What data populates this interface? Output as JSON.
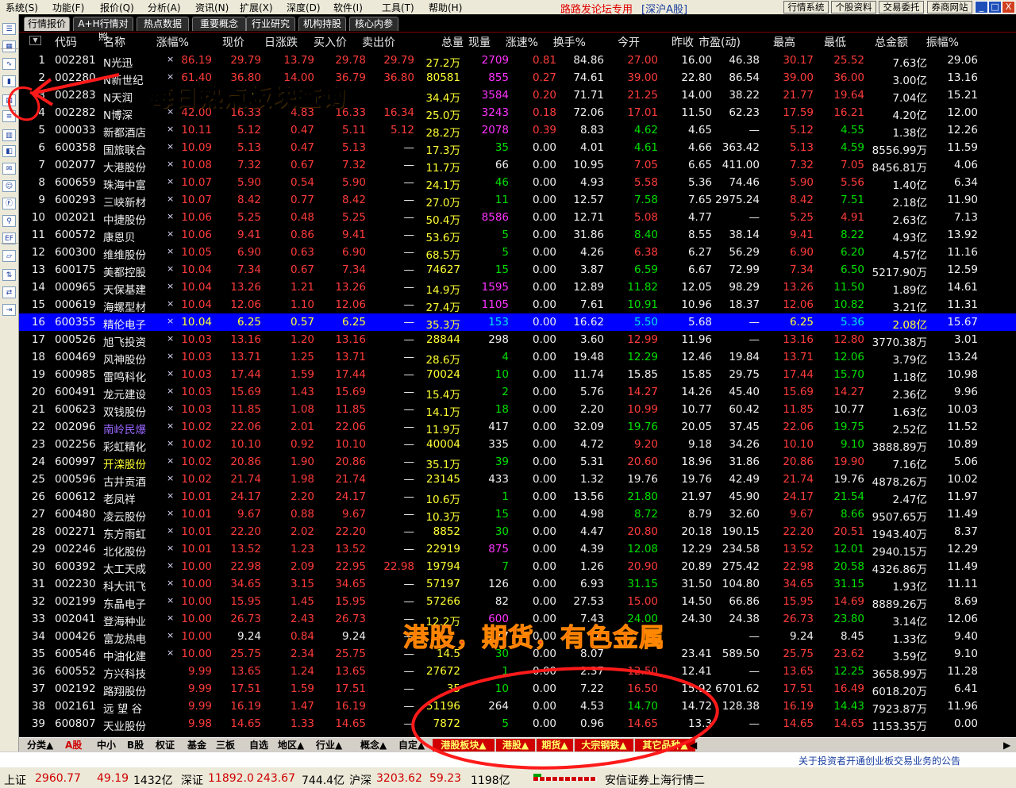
{
  "menu": {
    "items": [
      "系统(S)",
      "功能(F)",
      "报价(Q)",
      "分析(A)",
      "资讯(N)",
      "扩展(X)",
      "深度(D)",
      "软件(I)",
      "工具(T)",
      "帮助(H)"
    ],
    "center": "路路发论坛专用",
    "market": "[深沪A股]",
    "right_buttons": [
      "行情系统",
      "个股资料",
      "交易委托",
      "券商网站"
    ],
    "window_buttons": [
      "_",
      "□",
      "X"
    ]
  },
  "tabs": [
    "行情报价",
    "A+H行情对照",
    "热点数据",
    "重要概念",
    "行业研究",
    "机构持股",
    "核心内参"
  ],
  "header": {
    "columns": [
      "代码",
      "名称",
      "涨幅%",
      "现价",
      "日涨跌",
      "买入价",
      "卖出价",
      "总量",
      "现量",
      "涨速%",
      "换手%",
      "今开",
      "昨收",
      "市盈(动)",
      "最高",
      "最低",
      "总金额",
      "振幅%"
    ]
  },
  "rows": [
    [
      "1",
      "002281",
      "N光迅",
      "86.19",
      "29.79",
      "13.79",
      "29.78",
      "29.79",
      "27.2万",
      "2709",
      "0.81",
      "84.86",
      "27.00",
      "16.00",
      "46.38",
      "30.17",
      "25.52",
      "7.63亿",
      "29.06"
    ],
    [
      "2",
      "002280",
      "N新世纪",
      "61.40",
      "36.80",
      "14.00",
      "36.79",
      "36.80",
      "80581",
      "855",
      "0.27",
      "74.61",
      "39.00",
      "22.80",
      "86.54",
      "39.00",
      "36.00",
      "3.00亿",
      "13.16"
    ],
    [
      "3",
      "002283",
      "N天润",
      "",
      "",
      "",
      "",
      "",
      "34.4万",
      "3584",
      "0.20",
      "71.71",
      "21.25",
      "14.00",
      "38.22",
      "21.77",
      "19.64",
      "7.04亿",
      "15.21"
    ],
    [
      "4",
      "002282",
      "N博深",
      "42.00",
      "16.33",
      "4.83",
      "16.33",
      "16.34",
      "25.0万",
      "3243",
      "0.18",
      "72.06",
      "17.01",
      "11.50",
      "62.23",
      "17.59",
      "16.21",
      "4.20亿",
      "12.00"
    ],
    [
      "5",
      "000033",
      "新都酒店",
      "10.11",
      "5.12",
      "0.47",
      "5.11",
      "5.12",
      "28.2万",
      "2078",
      "0.39",
      "8.83",
      "4.62",
      "4.65",
      "—",
      "5.12",
      "4.55",
      "1.38亿",
      "12.26"
    ],
    [
      "6",
      "600358",
      "国旅联合",
      "10.09",
      "5.13",
      "0.47",
      "5.13",
      "—",
      "17.3万",
      "35",
      "0.00",
      "4.01",
      "4.61",
      "4.66",
      "363.42",
      "5.13",
      "4.59",
      "8556.99万",
      "11.59"
    ],
    [
      "7",
      "002077",
      "大港股份",
      "10.08",
      "7.32",
      "0.67",
      "7.32",
      "—",
      "11.7万",
      "66",
      "0.00",
      "10.95",
      "7.05",
      "6.65",
      "411.00",
      "7.32",
      "7.05",
      "8456.81万",
      "4.06"
    ],
    [
      "8",
      "600659",
      "珠海中富",
      "10.07",
      "5.90",
      "0.54",
      "5.90",
      "—",
      "24.1万",
      "46",
      "0.00",
      "4.93",
      "5.58",
      "5.36",
      "74.46",
      "5.90",
      "5.56",
      "1.40亿",
      "6.34"
    ],
    [
      "9",
      "600293",
      "三峡新材",
      "10.07",
      "8.42",
      "0.77",
      "8.42",
      "—",
      "27.0万",
      "11",
      "0.00",
      "12.57",
      "7.58",
      "7.65",
      "2975.24",
      "8.42",
      "7.51",
      "2.18亿",
      "11.90"
    ],
    [
      "10",
      "002021",
      "中捷股份",
      "10.06",
      "5.25",
      "0.48",
      "5.25",
      "—",
      "50.4万",
      "8586",
      "0.00",
      "12.71",
      "5.08",
      "4.77",
      "—",
      "5.25",
      "4.91",
      "2.63亿",
      "7.13"
    ],
    [
      "11",
      "600572",
      "康恩贝",
      "10.06",
      "9.41",
      "0.86",
      "9.41",
      "—",
      "53.6万",
      "5",
      "0.00",
      "31.86",
      "8.40",
      "8.55",
      "38.14",
      "9.41",
      "8.22",
      "4.93亿",
      "13.92"
    ],
    [
      "12",
      "600300",
      "维维股份",
      "10.05",
      "6.90",
      "0.63",
      "6.90",
      "—",
      "68.5万",
      "5",
      "0.00",
      "4.26",
      "6.38",
      "6.27",
      "56.29",
      "6.90",
      "6.20",
      "4.57亿",
      "11.16"
    ],
    [
      "13",
      "600175",
      "美都控股",
      "10.04",
      "7.34",
      "0.67",
      "7.34",
      "—",
      "74627",
      "15",
      "0.00",
      "3.87",
      "6.59",
      "6.67",
      "72.99",
      "7.34",
      "6.50",
      "5217.90万",
      "12.59"
    ],
    [
      "14",
      "000965",
      "天保基建",
      "10.04",
      "13.26",
      "1.21",
      "13.26",
      "—",
      "14.9万",
      "1595",
      "0.00",
      "12.89",
      "11.82",
      "12.05",
      "98.29",
      "13.26",
      "11.50",
      "1.89亿",
      "14.61"
    ],
    [
      "15",
      "000619",
      "海螺型材",
      "10.04",
      "12.06",
      "1.10",
      "12.06",
      "—",
      "27.4万",
      "1105",
      "0.00",
      "7.61",
      "10.91",
      "10.96",
      "18.37",
      "12.06",
      "10.82",
      "3.21亿",
      "11.31"
    ],
    [
      "16",
      "600355",
      "精伦电子",
      "10.04",
      "6.25",
      "0.57",
      "6.25",
      "—",
      "35.3万",
      "153",
      "0.00",
      "16.62",
      "5.50",
      "5.68",
      "—",
      "6.25",
      "5.36",
      "2.08亿",
      "15.67"
    ],
    [
      "17",
      "000526",
      "旭飞投资",
      "10.03",
      "13.16",
      "1.20",
      "13.16",
      "—",
      "28844",
      "298",
      "0.00",
      "3.60",
      "12.99",
      "11.96",
      "—",
      "13.16",
      "12.80",
      "3770.38万",
      "3.01"
    ],
    [
      "18",
      "600469",
      "风神股份",
      "10.03",
      "13.71",
      "1.25",
      "13.71",
      "—",
      "28.6万",
      "4",
      "0.00",
      "19.48",
      "12.29",
      "12.46",
      "19.84",
      "13.71",
      "12.06",
      "3.79亿",
      "13.24"
    ],
    [
      "19",
      "600985",
      "雷鸣科化",
      "10.03",
      "17.44",
      "1.59",
      "17.44",
      "—",
      "70024",
      "10",
      "0.00",
      "11.74",
      "15.85",
      "15.85",
      "29.75",
      "17.44",
      "15.70",
      "1.18亿",
      "10.98"
    ],
    [
      "20",
      "600491",
      "龙元建设",
      "10.03",
      "15.69",
      "1.43",
      "15.69",
      "—",
      "15.4万",
      "2",
      "0.00",
      "5.76",
      "14.27",
      "14.26",
      "45.40",
      "15.69",
      "14.27",
      "2.36亿",
      "9.96"
    ],
    [
      "21",
      "600623",
      "双钱股份",
      "10.03",
      "11.85",
      "1.08",
      "11.85",
      "—",
      "14.1万",
      "18",
      "0.00",
      "2.20",
      "10.99",
      "10.77",
      "60.42",
      "11.85",
      "10.77",
      "1.63亿",
      "10.03"
    ],
    [
      "22",
      "002096",
      "南岭民爆",
      "10.02",
      "22.06",
      "2.01",
      "22.06",
      "—",
      "11.9万",
      "417",
      "0.00",
      "32.09",
      "19.76",
      "20.05",
      "37.45",
      "22.06",
      "19.75",
      "2.52亿",
      "11.52"
    ],
    [
      "23",
      "002256",
      "彩虹精化",
      "10.02",
      "10.10",
      "0.92",
      "10.10",
      "—",
      "40004",
      "335",
      "0.00",
      "4.72",
      "9.20",
      "9.18",
      "34.26",
      "10.10",
      "9.10",
      "3888.89万",
      "10.89"
    ],
    [
      "24",
      "600997",
      "开滦股份",
      "10.02",
      "20.86",
      "1.90",
      "20.86",
      "—",
      "35.1万",
      "39",
      "0.00",
      "5.31",
      "20.60",
      "18.96",
      "31.86",
      "20.86",
      "19.90",
      "7.16亿",
      "5.06"
    ],
    [
      "25",
      "000596",
      "古井贡酒",
      "10.02",
      "21.74",
      "1.98",
      "21.74",
      "—",
      "23145",
      "433",
      "0.00",
      "1.32",
      "19.76",
      "19.76",
      "42.49",
      "21.74",
      "19.76",
      "4878.26万",
      "10.02"
    ],
    [
      "26",
      "600612",
      "老凤祥",
      "10.01",
      "24.17",
      "2.20",
      "24.17",
      "—",
      "10.6万",
      "1",
      "0.00",
      "13.56",
      "21.80",
      "21.97",
      "45.90",
      "24.17",
      "21.54",
      "2.47亿",
      "11.97"
    ],
    [
      "27",
      "600480",
      "凌云股份",
      "10.01",
      "9.67",
      "0.88",
      "9.67",
      "—",
      "10.3万",
      "15",
      "0.00",
      "4.98",
      "8.72",
      "8.79",
      "32.60",
      "9.67",
      "8.66",
      "9507.65万",
      "11.49"
    ],
    [
      "28",
      "002271",
      "东方雨虹",
      "10.01",
      "22.20",
      "2.02",
      "22.20",
      "—",
      "8852",
      "30",
      "0.00",
      "4.47",
      "20.80",
      "20.18",
      "190.15",
      "22.20",
      "20.51",
      "1943.40万",
      "8.37"
    ],
    [
      "29",
      "002246",
      "北化股份",
      "10.01",
      "13.52",
      "1.23",
      "13.52",
      "—",
      "22919",
      "875",
      "0.00",
      "4.39",
      "12.08",
      "12.29",
      "234.58",
      "13.52",
      "12.01",
      "2940.15万",
      "12.29"
    ],
    [
      "30",
      "600392",
      "太工天成",
      "10.00",
      "22.98",
      "2.09",
      "22.95",
      "22.98",
      "19794",
      "7",
      "0.00",
      "1.26",
      "20.90",
      "20.89",
      "275.42",
      "22.98",
      "20.58",
      "4326.86万",
      "11.49"
    ],
    [
      "31",
      "002230",
      "科大讯飞",
      "10.00",
      "34.65",
      "3.15",
      "34.65",
      "—",
      "57197",
      "126",
      "0.00",
      "6.93",
      "31.15",
      "31.50",
      "104.80",
      "34.65",
      "31.15",
      "1.93亿",
      "11.11"
    ],
    [
      "32",
      "002199",
      "东晶电子",
      "10.00",
      "15.95",
      "1.45",
      "15.95",
      "—",
      "57266",
      "82",
      "0.00",
      "27.53",
      "15.00",
      "14.50",
      "66.86",
      "15.95",
      "14.69",
      "8889.26万",
      "8.69"
    ],
    [
      "33",
      "002041",
      "登海种业",
      "10.00",
      "26.73",
      "2.43",
      "26.73",
      "—",
      "12.2万",
      "600",
      "0.00",
      "7.43",
      "24.00",
      "24.30",
      "24.38",
      "26.73",
      "23.80",
      "3.14亿",
      "12.06"
    ],
    [
      "34",
      "000426",
      "富龙热电",
      "10.00",
      "9.24",
      "0.84",
      "9.24",
      "—",
      "",
      "177",
      "0.00",
      "7.",
      "",
      "",
      "—",
      "9.24",
      "8.45",
      "1.33亿",
      "9.40"
    ],
    [
      "35",
      "600546",
      "中油化建",
      "10.00",
      "25.75",
      "2.34",
      "25.75",
      "—",
      "14.5",
      "30",
      "0.00",
      "8.07",
      "",
      "23.41",
      "589.50",
      "25.75",
      "23.62",
      "3.59亿",
      "9.10"
    ],
    [
      "36",
      "600552",
      "方兴科技",
      "9.99",
      "13.65",
      "1.24",
      "13.65",
      "—",
      "27672",
      "1",
      "0.00",
      "2.37",
      "12.50",
      "12.41",
      "—",
      "13.65",
      "12.25",
      "3658.99万",
      "11.28"
    ],
    [
      "37",
      "002192",
      "路翔股份",
      "9.99",
      "17.51",
      "1.59",
      "17.51",
      "—",
      "35",
      "10",
      "0.00",
      "7.22",
      "16.50",
      "15.92",
      "6701.62",
      "17.51",
      "16.49",
      "6018.20万",
      "6.41"
    ],
    [
      "38",
      "002161",
      "远 望 谷",
      "9.99",
      "16.19",
      "1.47",
      "16.19",
      "—",
      "51196",
      "264",
      "0.00",
      "4.53",
      "14.70",
      "14.72",
      "128.38",
      "16.19",
      "14.43",
      "7923.87万",
      "11.96"
    ],
    [
      "39",
      "600807",
      "天业股份",
      "9.98",
      "14.65",
      "1.33",
      "14.65",
      "—",
      "7872",
      "5",
      "0.00",
      "0.96",
      "14.65",
      "13.3",
      "—",
      "14.65",
      "14.65",
      "1153.35万",
      "0.00"
    ]
  ],
  "bottom_tabs": [
    "分类▲",
    "A股",
    "中小",
    "B股",
    "权证",
    "基金",
    "三板",
    "自选",
    "地区▲",
    "行业▲",
    "概念▲",
    "自定▲",
    "港股板块▲",
    "港股▲",
    "期货▲",
    "大宗钢铁▲",
    "其它品种▲"
  ],
  "ticker": "关于投资者开通创业板交易业务的公告",
  "status": {
    "sh_label": "上证",
    "sh_index": "2960.77",
    "sh_chg": "49.19",
    "sh_amt": "1432亿",
    "sz_label": "深证",
    "sz_index": "11892.0",
    "sz_chg": "243.67",
    "sz_amt": "744.4亿",
    "hs_label": "沪深",
    "hs_index": "3203.62",
    "hs_chg": "59.23",
    "hs_amt": "1198亿",
    "broker": "安信证券上海行情二"
  },
  "annotations": {
    "text1": "每日热点板块查询",
    "text2": "港股，期货，有色金属"
  }
}
